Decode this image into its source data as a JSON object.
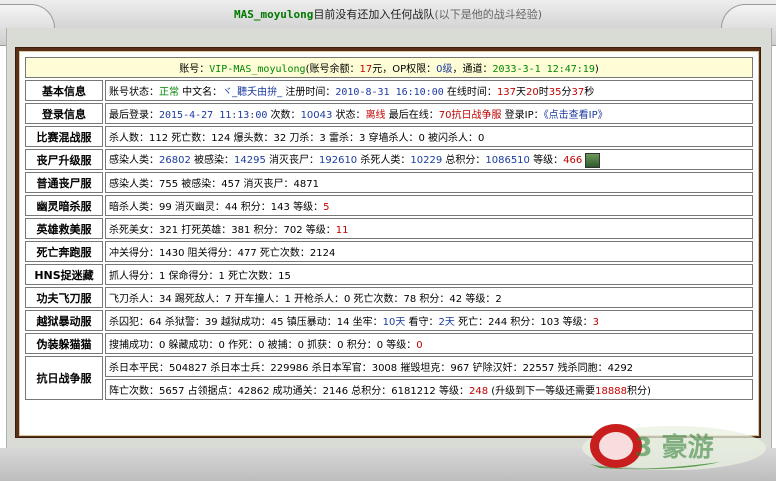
{
  "title": {
    "username": "MAS_moyulong",
    "message": "目前没有还加入任何战队",
    "note": "(以下是他的战斗经验)"
  },
  "header": {
    "account_prefix": "账号：",
    "account": "VIP-MAS_moyulong",
    "balance_prefix": "(账号余额：",
    "balance": "17",
    "balance_suffix": "元，OP权限：",
    "op": "0级",
    "channel_prefix": "，通道：",
    "channel_date": "2033-3-1 12:47:19",
    "end": ")"
  },
  "rows": {
    "basic": {
      "label": "基本信息",
      "status_label": "账号状态：",
      "status": "正常",
      "cn_label": " 中文名：",
      "cn_name": "ヾ_聽夭由拚_",
      "reg_label": " 注册时间：",
      "reg_time": "2010-8-31 16:10:00",
      "online_label": " 在线时间：",
      "days": "137",
      "d": "天",
      "hours": "20",
      "h": "时",
      "mins": "35",
      "m": "分",
      "secs": "37",
      "s": "秒"
    },
    "login": {
      "label": "登录信息",
      "last_login_label": "最后登录：",
      "last_login": "2015-4-27 11:13:00",
      "count_label": " 次数：",
      "count": "10043",
      "state_label": " 状态：",
      "state": "离线",
      "last_online_label": " 最后在线：",
      "last_online": "70抗日战争服",
      "ip_label": " 登录IP：",
      "ip": "《点击查看IP》"
    },
    "mixed": {
      "label": "比赛混战服",
      "text": "杀人数：112 死亡数：124 爆头数：32 刀杀：3 雷杀：3 穿墙杀人：0 被闪杀人：0"
    },
    "zombie_upgrade": {
      "label": "丧尸升级服",
      "infect_label": "感染人类：",
      "infect": "26802",
      "infected_label": " 被感染：",
      "infected": "14295",
      "kill_zombie_label": " 消灭丧尸：",
      "kill_zombie": "192610",
      "kill_human_label": " 杀死人类：",
      "kill_human": "10229",
      "score_label": " 总积分：",
      "score": "1086510",
      "level_label": " 等级：",
      "level": "466"
    },
    "zombie_normal": {
      "label": "普通丧尸服",
      "text": "感染人类：755 被感染：457 消灭丧尸：4871"
    },
    "ghost": {
      "label": "幽灵暗杀服",
      "text": "暗杀人类：99 消灭幽灵：44 积分：143 等级：",
      "level": "5"
    },
    "hero": {
      "label": "英雄救美服",
      "text": "杀死美女：321 打死英雄：381 积分：702 等级：",
      "level": "11"
    },
    "death_run": {
      "label": "死亡奔跑服",
      "text": "冲关得分：1430 阻关得分：477 死亡次数：2124"
    },
    "hns": {
      "label": "HNS捉迷藏",
      "text": "抓人得分：1 保命得分：1 死亡次数：15"
    },
    "kungfu": {
      "label": "功夫飞刀服",
      "text": "飞刀杀人：34 踢死敌人：7 开车撞人：1 开枪杀人：0 死亡次数：78 积分：42 等级：2"
    },
    "jailbreak": {
      "label": "越狱暴动服",
      "text_a": "杀囚犯：64 杀狱警：39 越狱成功：45 镇压暴动：14 坐牢：",
      "jail_days": "10天",
      "text_b": " 看守：",
      "guard_days": "2天",
      "text_c": " 死亡：244 积分：103 等级：",
      "level": "3"
    },
    "disguise": {
      "label": "伪装躲猫猫",
      "text": "搜捕成功：0 躲藏成功：0 作死：0 被捕：0 抓获：0 积分：0 等级：",
      "level": "0"
    },
    "war": {
      "label": "抗日战争服",
      "line1": "杀日本平民：504827 杀日本士兵：229986 杀日本军官：3008 摧毁坦克：967 铲除汉奸：22557 残杀同胞：4292",
      "line2_a": "阵亡次数：5657 占领据点：42862 成功通关：2146 总积分：6181212 等级：",
      "level": "248",
      "line2_b": " (升级到下一等级还需要",
      "need": "18888",
      "line2_c": "积分)"
    }
  },
  "logo": {
    "text": "3 豪游"
  },
  "colors": {
    "frame": "#5a2f1a",
    "label": "#8b0000",
    "header_bg": "#fffdd6",
    "value_blue": "#1a3aa0",
    "red": "#c00000",
    "green": "#008800"
  }
}
